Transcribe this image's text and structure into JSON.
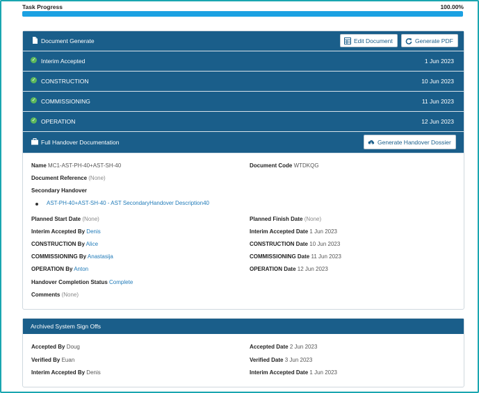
{
  "progress": {
    "label": "Task Progress",
    "value_text": "100.00%",
    "fraction": 1.0
  },
  "document_generate": {
    "title": "Document Generate",
    "edit_label": "Edit Document",
    "pdf_label": "Generate PDF"
  },
  "milestones": [
    {
      "label": "Interim Accepted",
      "date": "1 Jun 2023"
    },
    {
      "label": "CONSTRUCTION",
      "date": "10 Jun 2023"
    },
    {
      "label": "COMMISSIONING",
      "date": "11 Jun 2023"
    },
    {
      "label": "OPERATION",
      "date": "12 Jun 2023"
    }
  ],
  "handover": {
    "title": "Full Handover Documentation",
    "button_label": "Generate Handover Dossier"
  },
  "details": {
    "name_label": "Name",
    "name": "MC1-AST-PH-40+AST-SH-40",
    "code_label": "Document Code",
    "code": "WTDKQG",
    "ref_label": "Document Reference",
    "ref": "(None)",
    "secondary_label": "Secondary Handover",
    "secondary_link": "AST-PH-40+AST-SH-40 - AST SecondaryHandover Description40",
    "planned_start_label": "Planned Start Date",
    "planned_start": "(None)",
    "planned_finish_label": "Planned Finish Date",
    "planned_finish": "(None)",
    "interim_by_label": "Interim Accepted By",
    "interim_by": "Denis",
    "interim_date_label": "Interim Accepted Date",
    "interim_date": "1 Jun 2023",
    "construction_by_label": "CONSTRUCTION By",
    "construction_by": "Alice",
    "construction_date_label": "CONSTRUCTION Date",
    "construction_date": "10 Jun 2023",
    "commissioning_by_label": "COMMISSIONING By",
    "commissioning_by": "Anastasija",
    "commissioning_date_label": "COMMISSIONING Date",
    "commissioning_date": "11 Jun 2023",
    "operation_by_label": "OPERATION By",
    "operation_by": "Anton",
    "operation_date_label": "OPERATION Date",
    "operation_date": "12 Jun 2023",
    "completion_label": "Handover Completion Status",
    "completion": "Complete",
    "comments_label": "Comments",
    "comments": "(None)"
  },
  "archived": {
    "title": "Archived System Sign Offs",
    "accepted_by_label": "Accepted By",
    "accepted_by": "Doug",
    "accepted_date_label": "Accepted Date",
    "accepted_date": "2 Jun 2023",
    "verified_by_label": "Verified By",
    "verified_by": "Euan",
    "verified_date_label": "Verified Date",
    "verified_date": "3 Jun 2023",
    "interim_by_label": "Interim Accepted By",
    "interim_by": "Denis",
    "interim_date_label": "Interim Accepted Date",
    "interim_date": "1 Jun 2023"
  },
  "colors": {
    "header": "#1a5e8a",
    "progress": "#1ba1e2",
    "check": "#5cb85c",
    "link": "#1f7ab8",
    "frame": "#1aa6b0"
  }
}
